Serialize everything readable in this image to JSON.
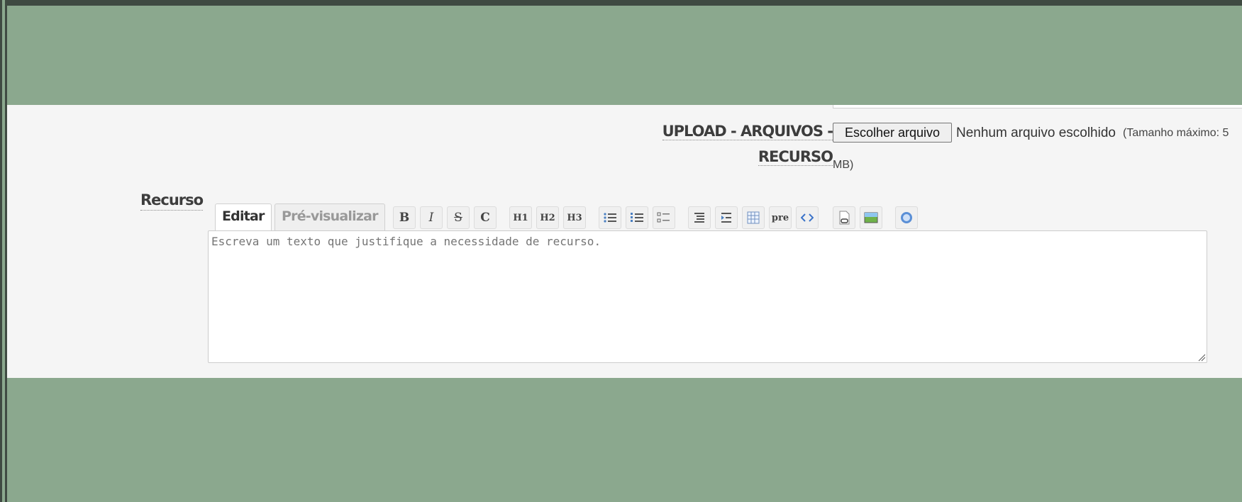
{
  "upload": {
    "label_line1": "UPLOAD - ARQUIVOS -",
    "label_line2": "RECURSO",
    "button_label": "Escolher arquivo",
    "status": "Nenhum arquivo escolhido",
    "hint": "(Tamanho máximo: 5",
    "hint_cont": "MB)"
  },
  "recurso": {
    "label": "Recurso",
    "tabs": [
      "Editar",
      "Pré-visualizar"
    ],
    "placeholder": "Escreva um texto que justifique a necessidade de recurso.",
    "toolbar": {
      "bold": "B",
      "italic": "I",
      "strike": "S",
      "code": "C",
      "h1": "H1",
      "h2": "H2",
      "h3": "H3",
      "pre": "pre",
      "icons": [
        "bold-icon",
        "italic-icon",
        "strikethrough-icon",
        "inline-code-icon",
        "heading1-icon",
        "heading2-icon",
        "heading3-icon",
        "bullet-list-icon",
        "numbered-list-icon",
        "checklist-icon",
        "quote-icon",
        "indent-icon",
        "table-icon",
        "pre-icon",
        "code-block-icon",
        "attachment-icon",
        "image-icon",
        "help-icon"
      ]
    }
  },
  "colors": {
    "background": "#8ba88e",
    "panel": "#f5f5f5",
    "border": "#3f4a42"
  }
}
